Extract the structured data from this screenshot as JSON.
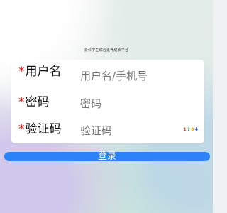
{
  "page": {
    "title": "云科学生综合素养成长平台"
  },
  "form": {
    "required_mark": "*",
    "username": {
      "label": "用户名",
      "placeholder": "用户名/手机号"
    },
    "password": {
      "label": "密码",
      "placeholder": "密码"
    },
    "captcha": {
      "label": "验证码",
      "placeholder": "验证码",
      "code": [
        "1",
        "?",
        "8",
        "4"
      ]
    }
  },
  "actions": {
    "login_label": "登录"
  },
  "colors": {
    "accent": "#2b83f7",
    "required": "#e50000"
  },
  "icons": {
    "captcha": "captcha-image-icon"
  }
}
